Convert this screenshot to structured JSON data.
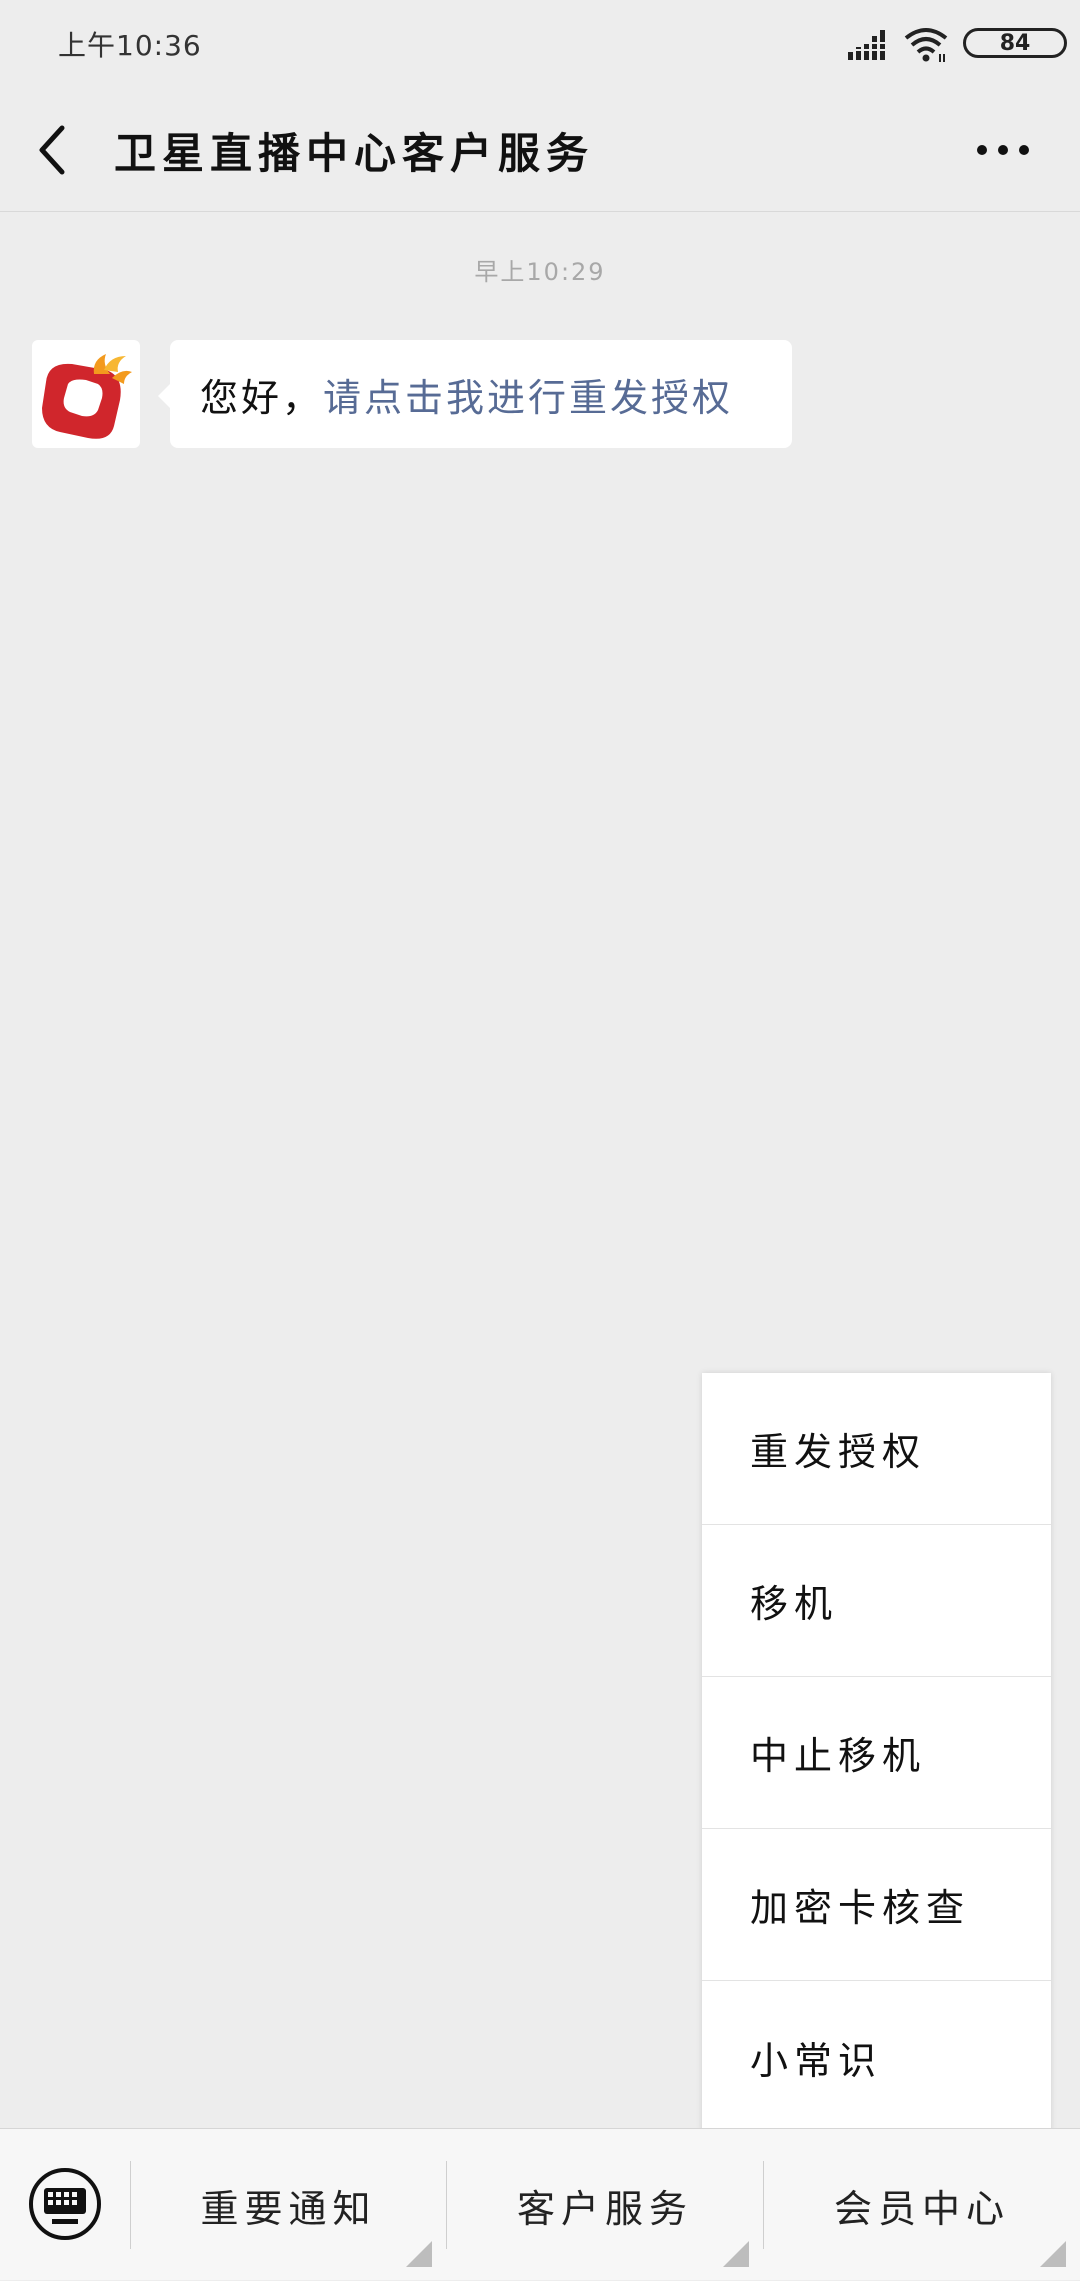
{
  "status_bar": {
    "time": "上午10:36",
    "battery": "84"
  },
  "header": {
    "title": "卫星直播中心客户服务"
  },
  "chat": {
    "timestamp": "早上10:29",
    "message": {
      "greeting": "您好，",
      "link_text": "请点击我进行重发授权"
    }
  },
  "popup_menu": {
    "items": [
      {
        "label": "重发授权"
      },
      {
        "label": "移机"
      },
      {
        "label": "中止移机"
      },
      {
        "label": "加密卡核查"
      },
      {
        "label": "小常识"
      }
    ]
  },
  "bottom_menu": {
    "tabs": [
      {
        "label": "重要通知"
      },
      {
        "label": "客户服务"
      },
      {
        "label": "会员中心"
      }
    ]
  },
  "colors": {
    "background": "#ededed",
    "link": "#576b95",
    "logo_red": "#d0262c",
    "logo_orange": "#f39a1e"
  }
}
